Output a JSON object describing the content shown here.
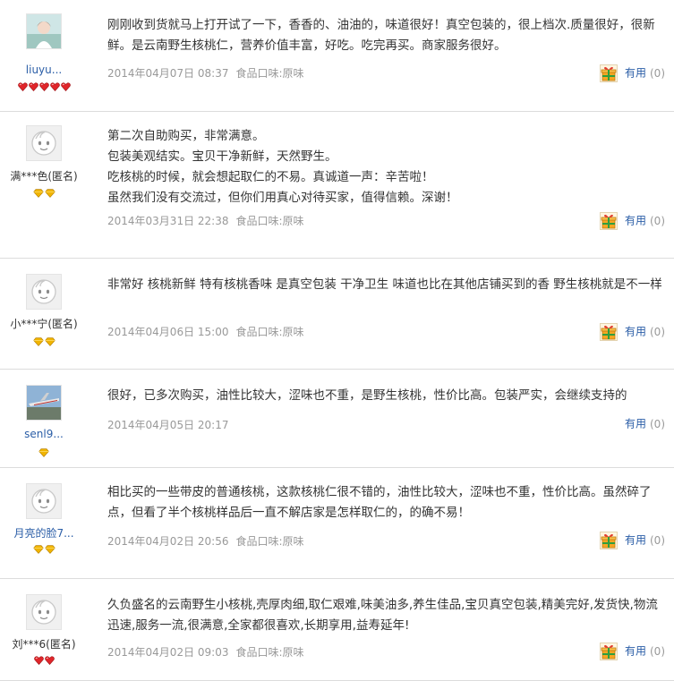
{
  "reviews": [
    {
      "user": "liuyu...",
      "avatar": "user-photo-girl",
      "gems": {
        "count": 5,
        "type": "red-heart"
      },
      "content": "刚刚收到货就马上打开试了一下，香香的、油油的，味道很好！真空包装的，很上档次.质量很好，很新鲜。是云南野生核桃仁，营养价值丰富，好吃。吃完再买。商家服务很好。",
      "date": "2014年04月07日 08:37",
      "attr": "食品口味:原味",
      "useful_label": "有用",
      "useful_count": "(0)"
    },
    {
      "user": "满***色(匿名)",
      "avatar": "default-avatar",
      "gems": {
        "count": 2,
        "type": "yellow-diamond"
      },
      "content": "第二次自助购买，非常满意。\n包装美观结实。宝贝干净新鲜，天然野生。\n吃核桃的时候，就会想起取仁的不易。真诚道一声：辛苦啦！\n虽然我们没有交流过，但你们用真心对待买家，值得信赖。深谢！",
      "date": "2014年03月31日 22:38",
      "attr": "食品口味:原味",
      "useful_label": "有用",
      "useful_count": "(0)"
    },
    {
      "user": "小***宁(匿名)",
      "avatar": "default-avatar",
      "gems": {
        "count": 2,
        "type": "yellow-diamond"
      },
      "content": "非常好 核桃新鲜 特有核桃香味 是真空包装 干净卫生 味道也比在其他店铺买到的香 野生核桃就是不一样",
      "date": "2014年04月06日 15:00",
      "attr": "食品口味:原味",
      "useful_label": "有用",
      "useful_count": "(0)"
    },
    {
      "user": "senl9...",
      "avatar": "user-photo-plane",
      "gems": {
        "count": 1,
        "type": "yellow-diamond"
      },
      "content": "很好，已多次购买，油性比较大，涩味也不重，是野生核桃，性价比高。包装严实，会继续支持的",
      "date": "2014年04月05日 20:17",
      "attr": "",
      "useful_label": "有用",
      "useful_count": "(0)"
    },
    {
      "user": "月亮的脸7...",
      "avatar": "default-avatar",
      "gems": {
        "count": 2,
        "type": "yellow-diamond"
      },
      "content": "相比买的一些带皮的普通核桃，这款核桃仁很不错的，油性比较大，涩味也不重，性价比高。虽然碎了点，但看了半个核桃样品后一直不解店家是怎样取仁的，的确不易！",
      "date": "2014年04月02日 20:56",
      "attr": "食品口味:原味",
      "useful_label": "有用",
      "useful_count": "(0)"
    },
    {
      "user": "刘***6(匿名)",
      "avatar": "default-avatar",
      "gems": {
        "count": 2,
        "type": "red-heart"
      },
      "content": "久负盛名的云南野生小核桃,壳厚肉细,取仁艰难,味美油多,养生佳品,宝贝真空包装,精美完好,发货快,物流迅速,服务一流,很满意,全家都很喜欢,长期享用,益寿延年!",
      "date": "2014年04月02日 09:03",
      "attr": "食品口味:原味",
      "useful_label": "有用",
      "useful_count": "(0)"
    }
  ],
  "colors": {
    "link": "#2b5ea7",
    "meta": "#999999",
    "divider": "#dcdcdc",
    "red_gem": "#e0262b",
    "yellow_gem": "#f0b400"
  }
}
